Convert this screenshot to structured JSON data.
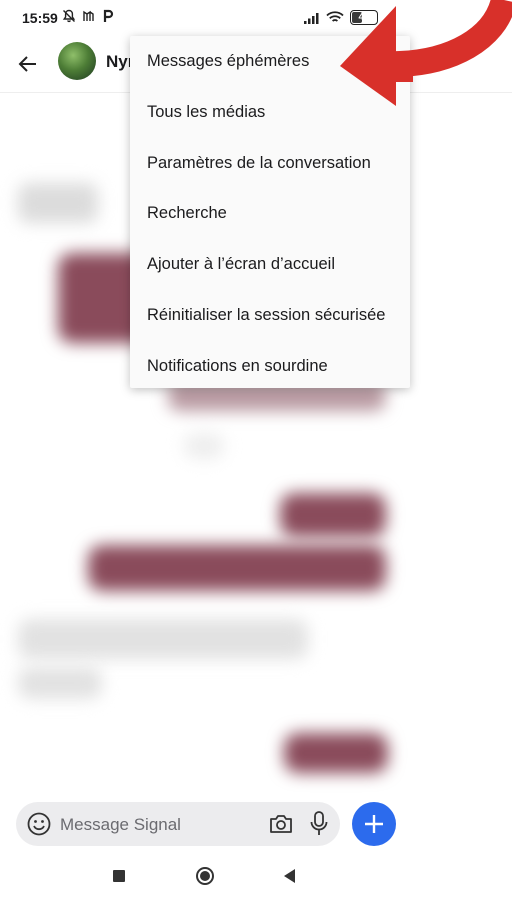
{
  "status_bar": {
    "time": "15:59",
    "battery_percent": "42"
  },
  "toolbar": {
    "contact_name": "Nym"
  },
  "menu": {
    "items": [
      "Messages éphémères",
      "Tous les médias",
      "Paramètres de la conversation",
      "Recherche",
      "Ajouter à l’écran d’accueil",
      "Réinitialiser la session sécurisée",
      "Notifications en sourdine"
    ]
  },
  "composer": {
    "placeholder": "Message Signal"
  },
  "colors": {
    "accent": "#2c6bed",
    "annotation_arrow": "#d8302a",
    "bubble_outgoing": "#8a4b5b"
  }
}
